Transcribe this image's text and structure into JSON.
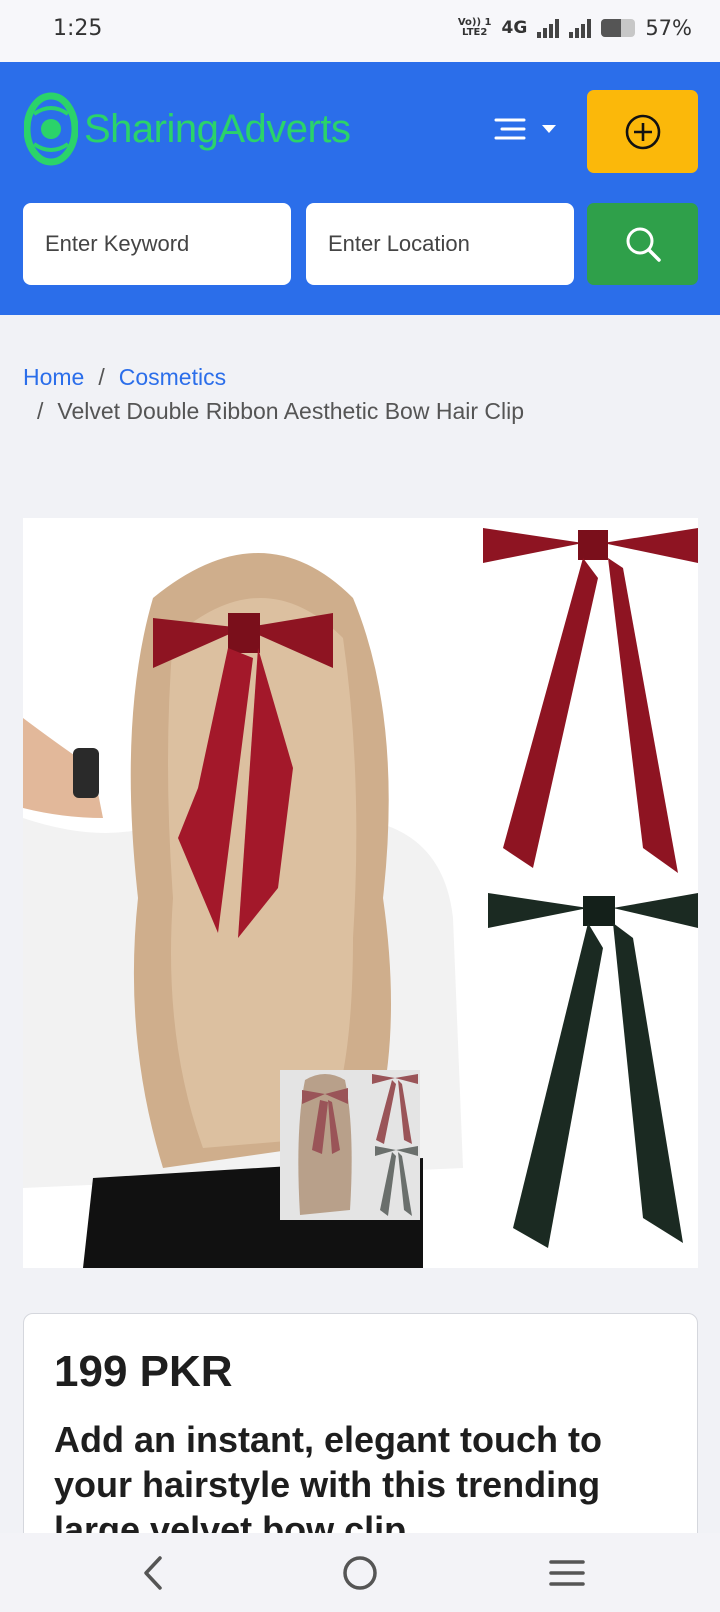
{
  "status_bar": {
    "time": "1:25",
    "network_label_top": "Vo)) 1",
    "network_label_bottom": "LTE2",
    "network_type": "4G",
    "battery_percent": "57%",
    "battery_level": 0.57
  },
  "header": {
    "logo_text": "SharingAdverts",
    "menu_icon": "hamburger-menu-icon",
    "add_icon": "plus-circle-icon",
    "search": {
      "keyword_placeholder": "Enter Keyword",
      "location_placeholder": "Enter Location",
      "button_icon": "search-icon"
    },
    "colors": {
      "bar": "#2b6eea",
      "logo": "#2bd36a",
      "add_button": "#fbb80a",
      "search_button": "#2fa04a"
    }
  },
  "breadcrumb": {
    "home": "Home",
    "category": "Cosmetics",
    "current": "Velvet Double Ribbon Aesthetic Bow Hair Clip",
    "separator": "/"
  },
  "product": {
    "price": "199 PKR",
    "description": "Add an instant, elegant touch to your hairstyle with this trending large velvet bow clip."
  },
  "nav_bar": {
    "back_icon": "back-chevron-icon",
    "home_icon": "home-circle-icon",
    "recents_icon": "recents-menu-icon"
  }
}
